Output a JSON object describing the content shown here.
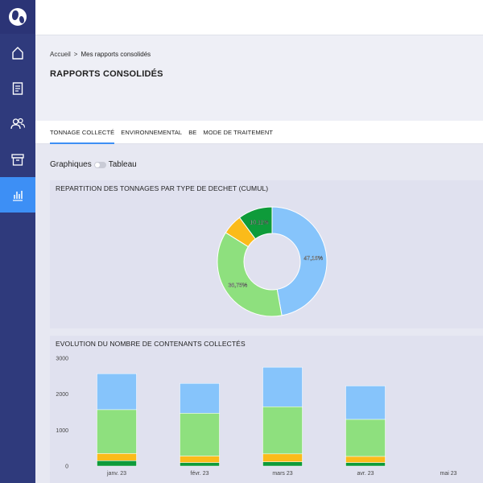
{
  "sidebar": {
    "logo_icon": "globe-logo-icon",
    "items": [
      {
        "name": "home",
        "icon": "home-icon",
        "active": false
      },
      {
        "name": "documents",
        "icon": "document-icon",
        "active": false
      },
      {
        "name": "users",
        "icon": "users-icon",
        "active": false
      },
      {
        "name": "archive",
        "icon": "archive-icon",
        "active": false
      },
      {
        "name": "reports",
        "icon": "bar-chart-icon",
        "active": true
      }
    ]
  },
  "breadcrumb": {
    "home": "Accueil",
    "separator": ">",
    "current": "Mes rapports consolidés"
  },
  "page_title": "RAPPORTS CONSOLIDÉS",
  "tabs": [
    {
      "label": "TONNAGE COLLECTÉ",
      "active": true
    },
    {
      "label": "ENVIRONNEMENTAL",
      "active": false
    },
    {
      "label": "BE",
      "active": false
    },
    {
      "label": "MODE DE TRAITEMENT",
      "active": false
    }
  ],
  "view_toggle": {
    "left_label": "Graphiques",
    "right_label": "Tableau"
  },
  "colors": {
    "accent": "#3d8ff5",
    "sidebar": "#2f3a7c",
    "blue": "#86c4fb",
    "green": "#8ee07e",
    "orange": "#fbbb1a",
    "dark_green": "#0e9b3a"
  },
  "chart_data": [
    {
      "type": "pie",
      "title": "REPARTITION DES TONNAGES PAR TYPE DE DECHET (CUMUL)",
      "slices": [
        {
          "value": 47.16,
          "label": "47,16%",
          "color": "#86c4fb"
        },
        {
          "value": 36.75,
          "label": "36,75%",
          "color": "#8ee07e"
        },
        {
          "value": 6.0,
          "label": "",
          "color": "#fbbb1a"
        },
        {
          "value": 10.11,
          "label": "10,11%",
          "color": "#0e9b3a"
        }
      ]
    },
    {
      "type": "bar",
      "title": "EVOLUTION DU NOMBRE DE CONTENANTS COLLECTÉS",
      "categories": [
        "janv. 23",
        "févr. 23",
        "mars 23",
        "avr. 23",
        "mai 23"
      ],
      "ylim": [
        0,
        3000
      ],
      "yticks": [
        "0",
        "1000",
        "2000",
        "3000"
      ],
      "stacked": true,
      "series": [
        {
          "color": "#0e9b3a",
          "values": [
            150,
            100,
            120,
            100,
            0
          ]
        },
        {
          "color": "#fbbb1a",
          "values": [
            200,
            180,
            220,
            170,
            0
          ]
        },
        {
          "color": "#8ee07e",
          "values": [
            1220,
            1190,
            1310,
            1030,
            0
          ]
        },
        {
          "color": "#86c4fb",
          "values": [
            1000,
            830,
            1100,
            930,
            0
          ]
        }
      ]
    }
  ]
}
